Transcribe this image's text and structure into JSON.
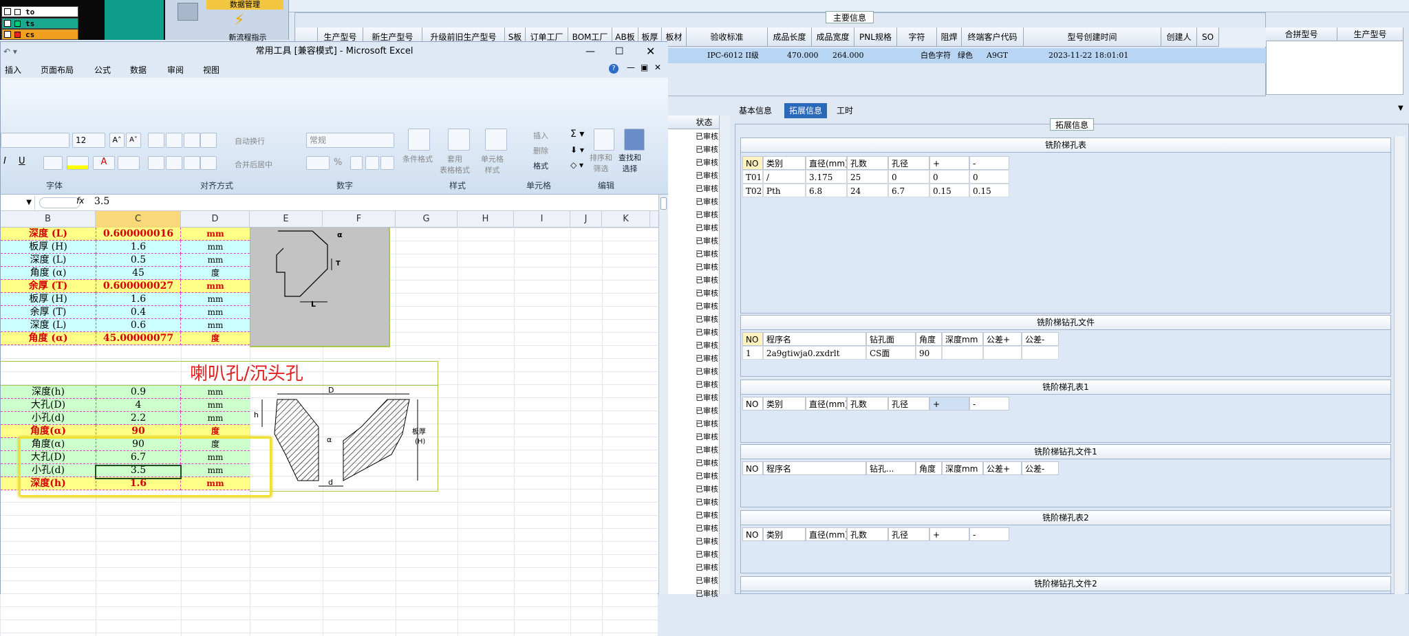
{
  "top_left": {
    "items": [
      {
        "code": "to",
        "color": "#ffffff"
      },
      {
        "code": "ts",
        "color": "#1aa890"
      },
      {
        "code": "cs",
        "color": "#f0a020"
      }
    ],
    "toolbar_labels": [
      "数据管理",
      "新流程指示"
    ]
  },
  "main_info": {
    "title": "主要信息",
    "columns": [
      "生产型号",
      "新生产型号",
      "升级前旧生产型号",
      "S板",
      "订单工厂",
      "BOM工厂",
      "AB板",
      "板厚",
      "板材",
      "验收标准",
      "成品长度",
      "成品宽度",
      "PNL规格",
      "字符",
      "阻焊",
      "终端客户代码",
      "型号创建时间",
      "创建人",
      "SO"
    ],
    "row": {
      "standard": "IPC-6012 II级",
      "length": "470.000",
      "width": "264.000",
      "char": "白色字符",
      "mask": "绿色",
      "customer": "A9GT",
      "created": "2023-11-22 18:01:01"
    },
    "right_columns": [
      "合拼型号",
      "生产型号"
    ]
  },
  "excel": {
    "title": "常用工具 [兼容模式] - Microsoft Excel",
    "menu": [
      "插入",
      "页面布局",
      "公式",
      "数据",
      "审阅",
      "视图"
    ],
    "font_size": "12",
    "number_format": "常规",
    "ribbon_labels": {
      "wrap": "自动换行",
      "merge": "合并后居中",
      "cond": "条件格式",
      "table_fmt": "套用\n表格格式",
      "cell_style": "单元格\n样式",
      "insert": "插入",
      "delete": "删除",
      "format": "格式",
      "sort": "排序和\n筛选",
      "find": "查找和\n选择"
    },
    "groups": [
      "字体",
      "对齐方式",
      "数字",
      "样式",
      "单元格",
      "编辑"
    ],
    "formula_value": "3.5",
    "fx": "fx",
    "columns": [
      "B",
      "C",
      "D",
      "E",
      "F",
      "G",
      "H",
      "I",
      "J",
      "K"
    ],
    "block1": [
      {
        "label": "深度 (L)",
        "value": "0.600000016",
        "unit": "mm",
        "style": "y"
      },
      {
        "label": "板厚 (H)",
        "value": "1.6",
        "unit": "mm",
        "style": "c"
      },
      {
        "label": "深度 (L)",
        "value": "0.5",
        "unit": "mm",
        "style": "c"
      },
      {
        "label": "角度 (α)",
        "value": "45",
        "unit": "度",
        "style": "c"
      },
      {
        "label": "余厚 (T)",
        "value": "0.600000027",
        "unit": "mm",
        "style": "y"
      },
      {
        "label": "板厚 (H)",
        "value": "1.6",
        "unit": "mm",
        "style": "c"
      },
      {
        "label": "余厚 (T)",
        "value": "0.4",
        "unit": "mm",
        "style": "c"
      },
      {
        "label": "深度 (L)",
        "value": "0.6",
        "unit": "mm",
        "style": "c"
      },
      {
        "label": "角度 (α)",
        "value": "45.00000077",
        "unit": "度",
        "style": "y"
      }
    ],
    "block2_title": "喇叭孔/沉头孔",
    "block2": [
      {
        "label": "深度(h)",
        "value": "0.9",
        "unit": "mm",
        "style": "g"
      },
      {
        "label": "大孔(D)",
        "value": "4",
        "unit": "mm",
        "style": "g"
      },
      {
        "label": "小孔(d)",
        "value": "2.2",
        "unit": "mm",
        "style": "g"
      },
      {
        "label": "角度(α)",
        "value": "90",
        "unit": "度",
        "style": "y"
      },
      {
        "label": "角度(α)",
        "value": "90",
        "unit": "度",
        "style": "g"
      },
      {
        "label": "大孔(D)",
        "value": "6.7",
        "unit": "mm",
        "style": "g"
      },
      {
        "label": "小孔(d)",
        "value": "3.5",
        "unit": "mm",
        "style": "g"
      },
      {
        "label": "深度(h)",
        "value": "1.6",
        "unit": "mm",
        "style": "y"
      }
    ],
    "diagram1_labels": {
      "alpha": "α",
      "T": "T",
      "L": "L"
    },
    "diagram2_labels": {
      "D": "D",
      "alpha": "α",
      "d": "d",
      "h": "h",
      "thick": "板厚",
      "H": "(H)"
    }
  },
  "status": {
    "header": "状态",
    "value": "已审核"
  },
  "tabs": [
    "基本信息",
    "拓展信息",
    "工时"
  ],
  "ext": {
    "title": "拓展信息",
    "t1": {
      "title": "铣阶梯孔表",
      "headers": [
        "NO",
        "类别",
        "直径(mm)",
        "孔数",
        "孔径",
        "+",
        "-"
      ],
      "rows": [
        [
          "T01",
          "/",
          "3.175",
          "25",
          "0",
          "0",
          "0"
        ],
        [
          "T02",
          "Pth",
          "6.8",
          "24",
          "6.7",
          "0.15",
          "0.15"
        ]
      ]
    },
    "t2": {
      "title": "铣阶梯钻孔文件",
      "headers": [
        "NO",
        "程序名",
        "钻孔面",
        "角度",
        "深度mm",
        "公差+",
        "公差-"
      ],
      "rows": [
        [
          "1",
          "2a9gtiwja0.zxdrlt",
          "CS面",
          "90",
          "",
          "",
          ""
        ]
      ]
    },
    "t3": {
      "title": "铣阶梯孔表1",
      "headers": [
        "NO",
        "类别",
        "直径(mm)",
        "孔数",
        "孔径",
        "+",
        "-"
      ]
    },
    "t4": {
      "title": "铣阶梯钻孔文件1",
      "headers": [
        "NO",
        "程序名",
        "钻孔...",
        "角度",
        "深度mm",
        "公差+",
        "公差-"
      ]
    },
    "t5": {
      "title": "铣阶梯孔表2",
      "headers": [
        "NO",
        "类别",
        "直径(mm)",
        "孔数",
        "孔径",
        "+",
        "-"
      ]
    },
    "t6": {
      "title": "铣阶梯钻孔文件2"
    }
  }
}
